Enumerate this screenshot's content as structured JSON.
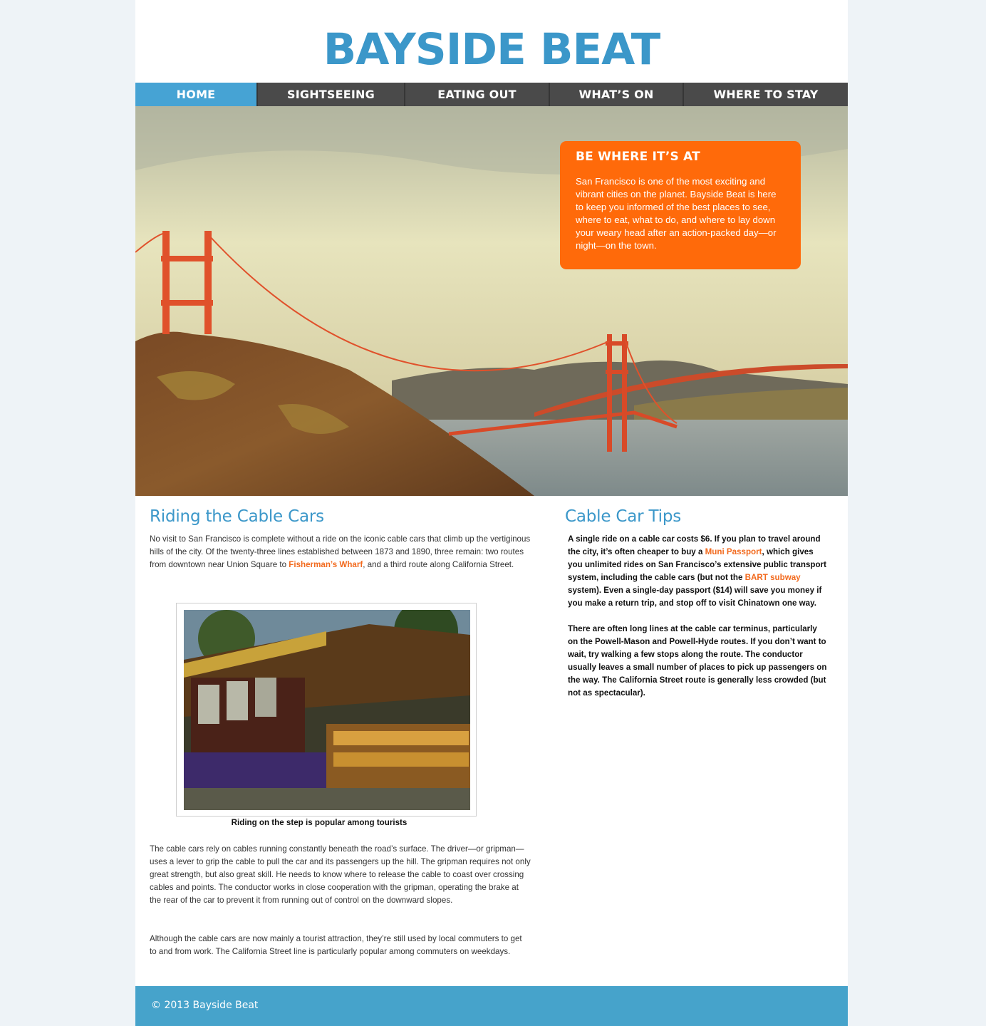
{
  "header": {
    "title": "BAYSIDE BEAT"
  },
  "nav": {
    "items": [
      {
        "label": "HOME"
      },
      {
        "label": "SIGHTSEEING"
      },
      {
        "label": "EATING OUT"
      },
      {
        "label": "WHAT’S ON"
      },
      {
        "label": "WHERE TO STAY"
      }
    ]
  },
  "hero": {
    "callout_title": "BE WHERE IT’S AT",
    "callout_text": "San Francisco is one of the most exciting and vibrant cities on the planet. Bayside Beat is here to keep you informed of the best places to see, where to eat, what to do, and where to lay down your weary head after an action-packed day—or night—on the town."
  },
  "main": {
    "heading": "Riding the Cable Cars",
    "p1_before": "No visit to San Francisco is complete without a ride on the iconic cable cars that climb up the vertiginous hills of the city. Of the twenty-three lines established between 1873 and 1890, three remain: two routes from downtown near Union Square to ",
    "p1_link": "Fisherman’s Wharf",
    "p1_after": ", and a third route along California Street.",
    "caption": "Riding on the step is popular among tourists",
    "p2": "The cable cars rely on cables running constantly beneath the road’s surface. The driver—or gripman—uses a lever to grip the cable to pull the car and its passengers up the hill. The gripman requires not only great strength, but also great skill. He needs to know where to release the cable to coast over crossing cables and points. The conductor works in close cooperation with the gripman, operating the brake at the rear of the car to prevent it from running out of control on the downward slopes.",
    "p3": "Although the cable cars are now mainly a tourist attraction, they’re still used by local commuters to get to and from work. The California Street line is particularly popular among commuters on weekdays."
  },
  "sidebar": {
    "heading": "Cable Car Tips",
    "t1_a": "A single ride on a cable car costs $6. If you plan to travel around the city, it’s often cheaper to buy a ",
    "t1_link1": "Muni Passport",
    "t1_b": ", which gives you unlimited rides on San Francisco’s extensive public transport system, including the cable cars (but not the ",
    "t1_link2": "BART subway",
    "t1_c": " system). Even a single-day passport ($14) will save you money if you make a return trip, and stop off to visit Chinatown one way.",
    "t2": "There are often long lines at the cable car terminus, particularly on the Powell-Mason and Powell-Hyde routes. If you don’t want to wait, try walking a few stops along the route. The conductor usually leaves a small number of places to pick up passengers on the way. The California Street route is generally less crowded (but not as spectacular)."
  },
  "footer": {
    "text": "© 2013 Bayside Beat"
  },
  "colors": {
    "brand_blue": "#3b97c9",
    "nav_dark": "#4a4a4a",
    "accent_orange": "#ff6a0a",
    "footer_blue": "#46a3cb"
  },
  "icons": {
    "hero_image": "golden-gate-bridge-photo",
    "figure_image": "cable-car-photo"
  }
}
